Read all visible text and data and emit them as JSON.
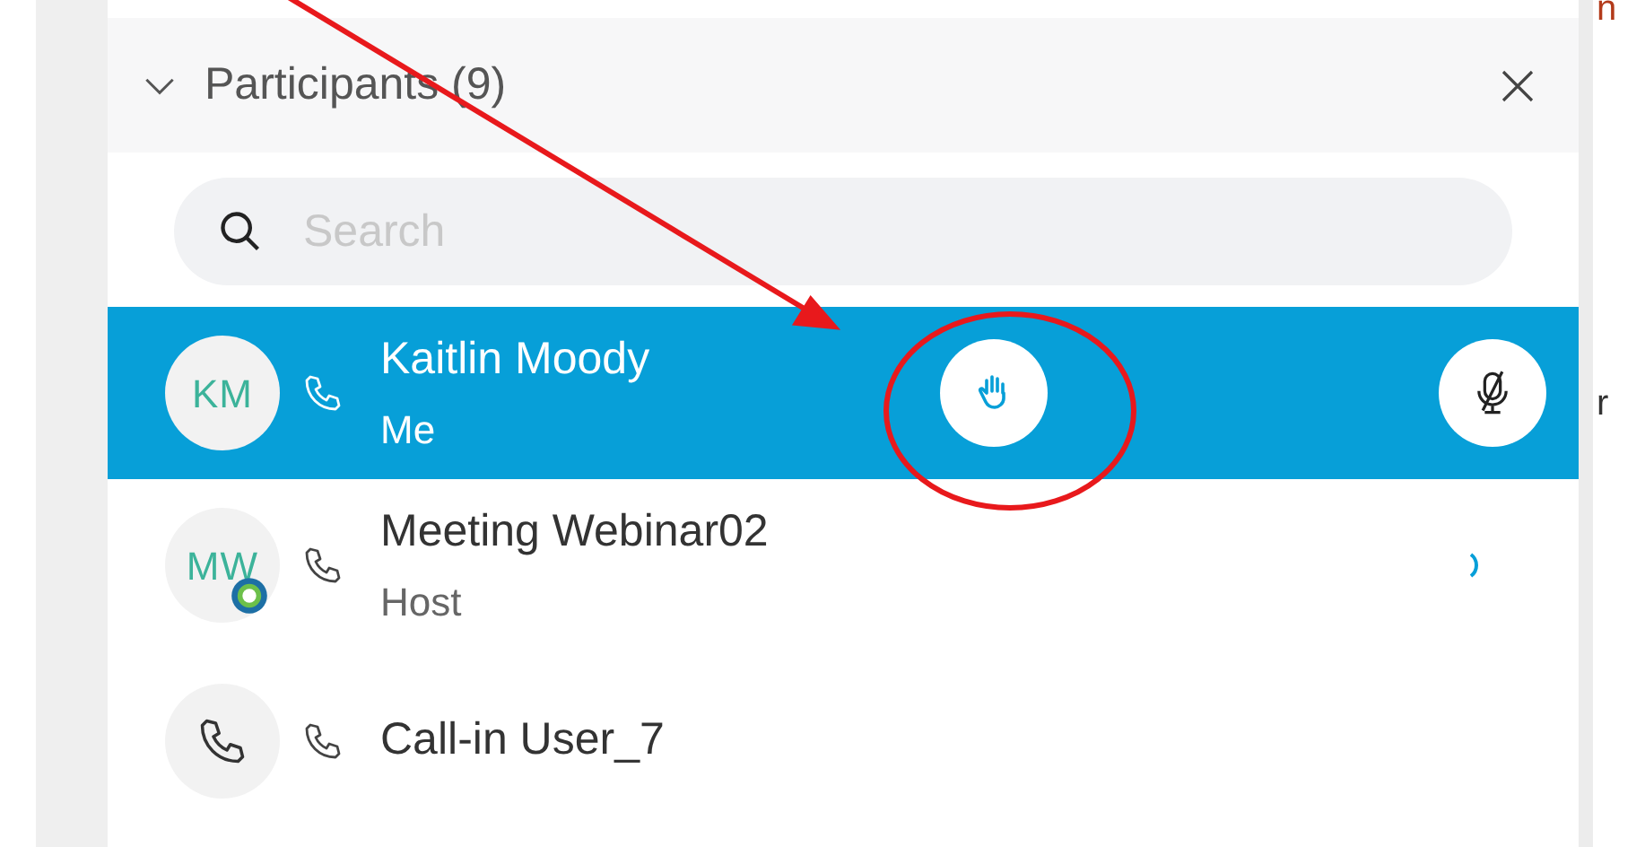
{
  "panel": {
    "title": "Participants (9)",
    "expanded": true,
    "search": {
      "placeholder": "Search"
    }
  },
  "participants": [
    {
      "name": "Kaitlin Moody",
      "role": "Me",
      "avatar": {
        "kind": "initials",
        "text": "KM"
      },
      "selected": true,
      "hand_raised": true,
      "muted": true,
      "badge": false,
      "speaking": false
    },
    {
      "name": "Meeting Webinar02",
      "role": "Host",
      "avatar": {
        "kind": "initials",
        "text": "MW"
      },
      "selected": false,
      "hand_raised": false,
      "muted": false,
      "badge": true,
      "speaking": true
    },
    {
      "name": "Call-in User_7",
      "avatar": {
        "kind": "phone"
      },
      "selected": false,
      "hand_raised": false,
      "muted": false,
      "badge": false,
      "speaking": false
    }
  ],
  "background_window": {
    "texts": [
      "n",
      "r"
    ]
  }
}
